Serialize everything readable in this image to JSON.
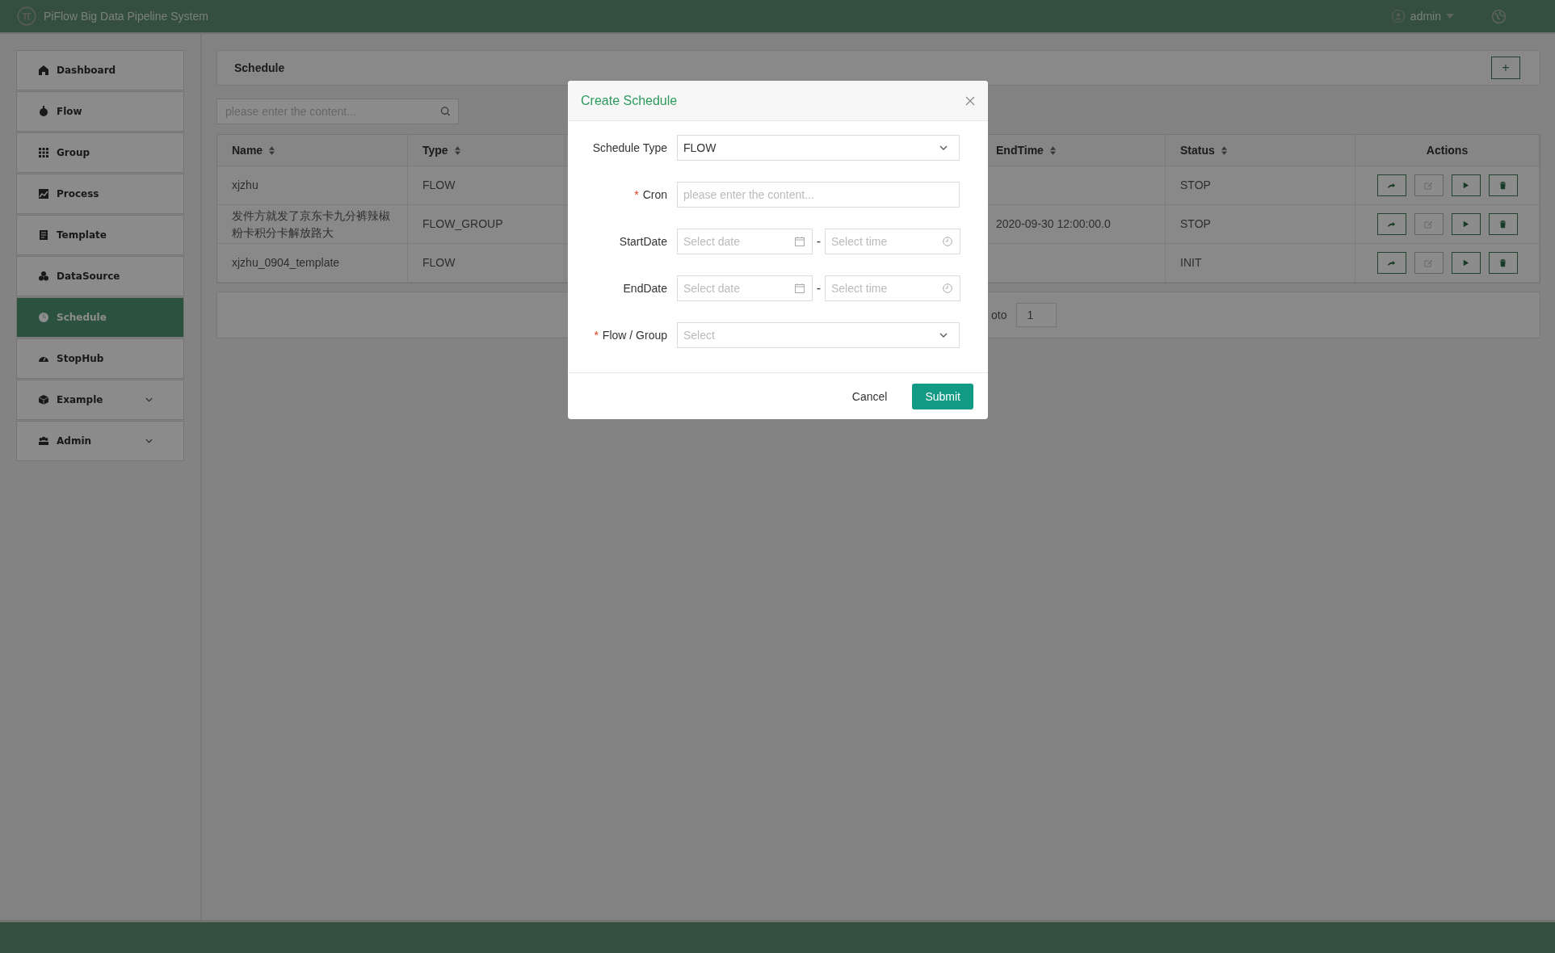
{
  "header": {
    "title": "PiFlow Big Data Pipeline System",
    "user": "admin"
  },
  "sidebar": {
    "items": [
      {
        "label": "Dashboard",
        "kind": "link",
        "selected": false
      },
      {
        "label": "Flow",
        "kind": "link",
        "selected": false
      },
      {
        "label": "Group",
        "kind": "link",
        "selected": false
      },
      {
        "label": "Process",
        "kind": "link",
        "selected": false
      },
      {
        "label": "Template",
        "kind": "link",
        "selected": false
      },
      {
        "label": "DataSource",
        "kind": "link",
        "selected": false
      },
      {
        "label": "Schedule",
        "kind": "link",
        "selected": true
      },
      {
        "label": "StopHub",
        "kind": "link",
        "selected": false
      },
      {
        "label": "Example",
        "kind": "submenu",
        "selected": false
      },
      {
        "label": "Admin",
        "kind": "submenu",
        "selected": false
      }
    ]
  },
  "page": {
    "title": "Schedule",
    "add_button": "+"
  },
  "search": {
    "placeholder": "please enter the content..."
  },
  "table": {
    "columns": [
      {
        "label": "Name",
        "sortable": true
      },
      {
        "label": "Type",
        "sortable": true
      },
      {
        "label": "EndTime",
        "sortable": true
      },
      {
        "label": "Status",
        "sortable": true
      },
      {
        "label": "Actions",
        "sortable": false
      }
    ],
    "rows": [
      {
        "name": "xjzhu",
        "type": "FLOW",
        "end_time": "",
        "status": "STOP",
        "actions": [
          {
            "kind": "share",
            "disabled": false
          },
          {
            "kind": "edit",
            "disabled": true
          },
          {
            "kind": "run",
            "disabled": false
          },
          {
            "kind": "delete",
            "disabled": false
          }
        ]
      },
      {
        "name": "发件方就发了京东卡九分裤辣椒粉卡积分卡解放路大",
        "type": "FLOW_GROUP",
        "end_time": "2020-09-30 12:00:00.0",
        "status": "STOP",
        "actions": [
          {
            "kind": "share",
            "disabled": false
          },
          {
            "kind": "edit",
            "disabled": true
          },
          {
            "kind": "run",
            "disabled": false
          },
          {
            "kind": "delete",
            "disabled": false
          }
        ]
      },
      {
        "name": "xjzhu_0904_template",
        "type": "FLOW",
        "end_time": "",
        "status": "INIT",
        "actions": [
          {
            "kind": "share",
            "disabled": false
          },
          {
            "kind": "edit",
            "disabled": true
          },
          {
            "kind": "run",
            "disabled": false
          },
          {
            "kind": "delete",
            "disabled": false
          }
        ]
      }
    ]
  },
  "pagination": {
    "goto_label": "oto",
    "goto_value": "1"
  },
  "modal": {
    "title": "Create Schedule",
    "fields": [
      {
        "label": "Schedule Type",
        "kind": "select",
        "required": false,
        "value": "FLOW"
      },
      {
        "label": "Cron",
        "kind": "text",
        "required": true,
        "placeholder": "please enter the content..."
      },
      {
        "label": "StartDate",
        "kind": "datetime",
        "required": false,
        "date_placeholder": "Select date",
        "separator": "-",
        "time_placeholder": "Select time"
      },
      {
        "label": "EndDate",
        "kind": "datetime",
        "required": false,
        "date_placeholder": "Select date",
        "separator": "-",
        "time_placeholder": "Select time"
      },
      {
        "label": "Flow / Group",
        "kind": "select",
        "required": true,
        "placeholder": "Select"
      }
    ],
    "required_mark": "*",
    "buttons": [
      "Cancel",
      "Submit"
    ]
  }
}
